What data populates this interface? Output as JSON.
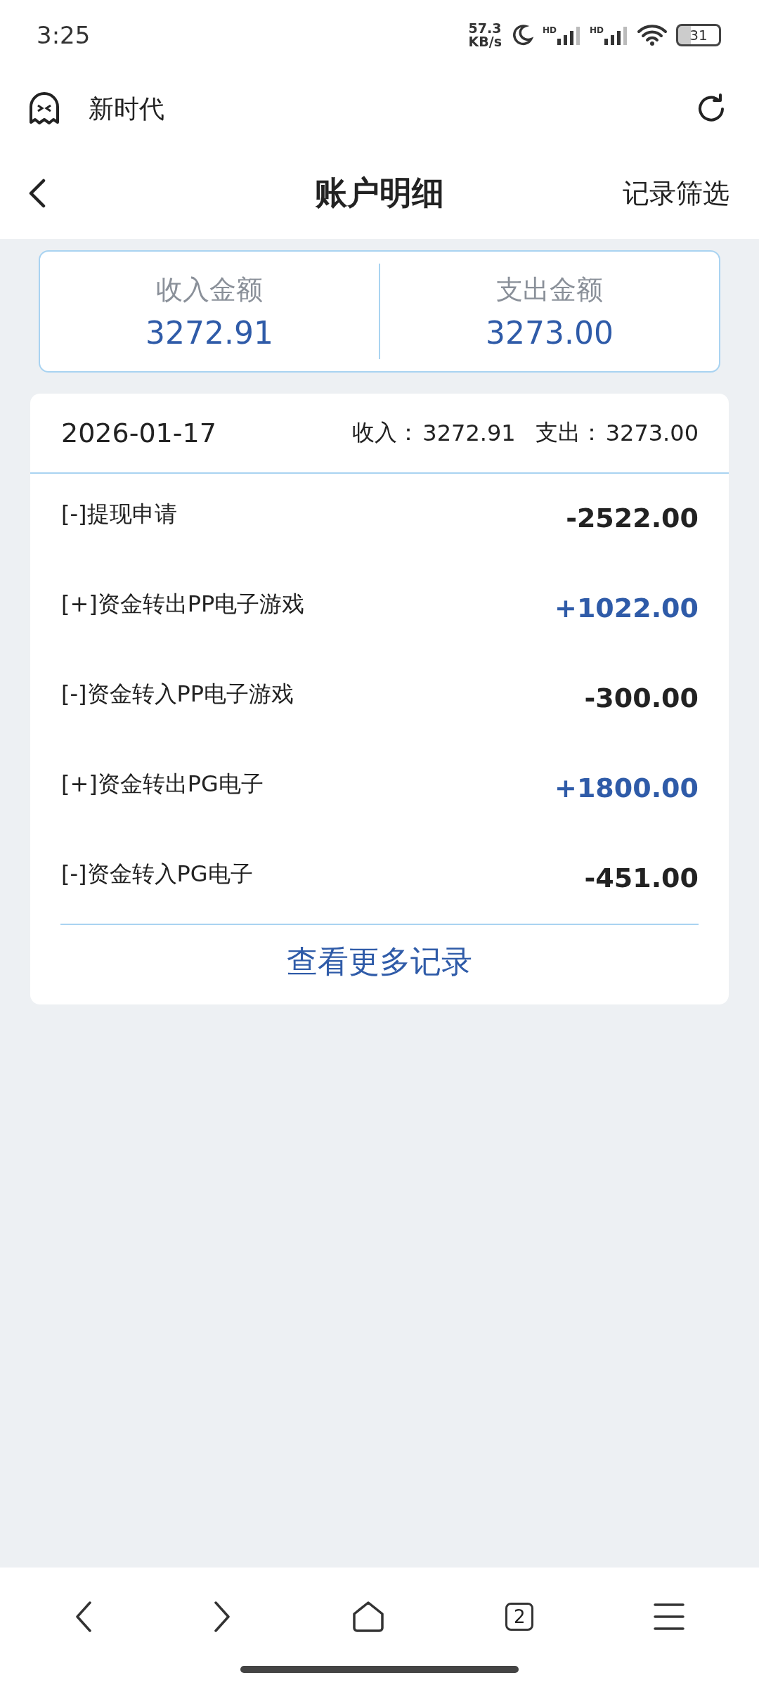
{
  "status_bar": {
    "time": "3:25",
    "net_speed_value": "57.3",
    "net_speed_unit": "KB/s",
    "signal_labels": [
      "HD",
      "HD"
    ],
    "battery": "31"
  },
  "browser_bar": {
    "title": "新时代"
  },
  "header": {
    "title": "账户明细",
    "action": "记录筛选"
  },
  "summary": [
    {
      "label": "收入金额",
      "amount": "3272.91"
    },
    {
      "label": "支出金额",
      "amount": "3273.00"
    }
  ],
  "day": {
    "date": "2026-01-17",
    "income_label": "收入：",
    "income": "3272.91",
    "expense_label": "支出：",
    "expense": "3273.00",
    "transactions": [
      {
        "kind": "expense",
        "title": "[-]提现申请",
        "amount": "-2522.00"
      },
      {
        "kind": "income",
        "title": "[+]资金转出PP电子游戏",
        "amount": "+1022.00"
      },
      {
        "kind": "expense",
        "title": "[-]资金转入PP电子游戏",
        "amount": "-300.00"
      },
      {
        "kind": "income",
        "title": "[+]资金转出PG电子",
        "amount": "+1800.00"
      },
      {
        "kind": "expense",
        "title": "[-]资金转入PG电子",
        "amount": "-451.00"
      }
    ],
    "more": "查看更多记录"
  },
  "bottom_nav": {
    "tabs_count": "2"
  }
}
